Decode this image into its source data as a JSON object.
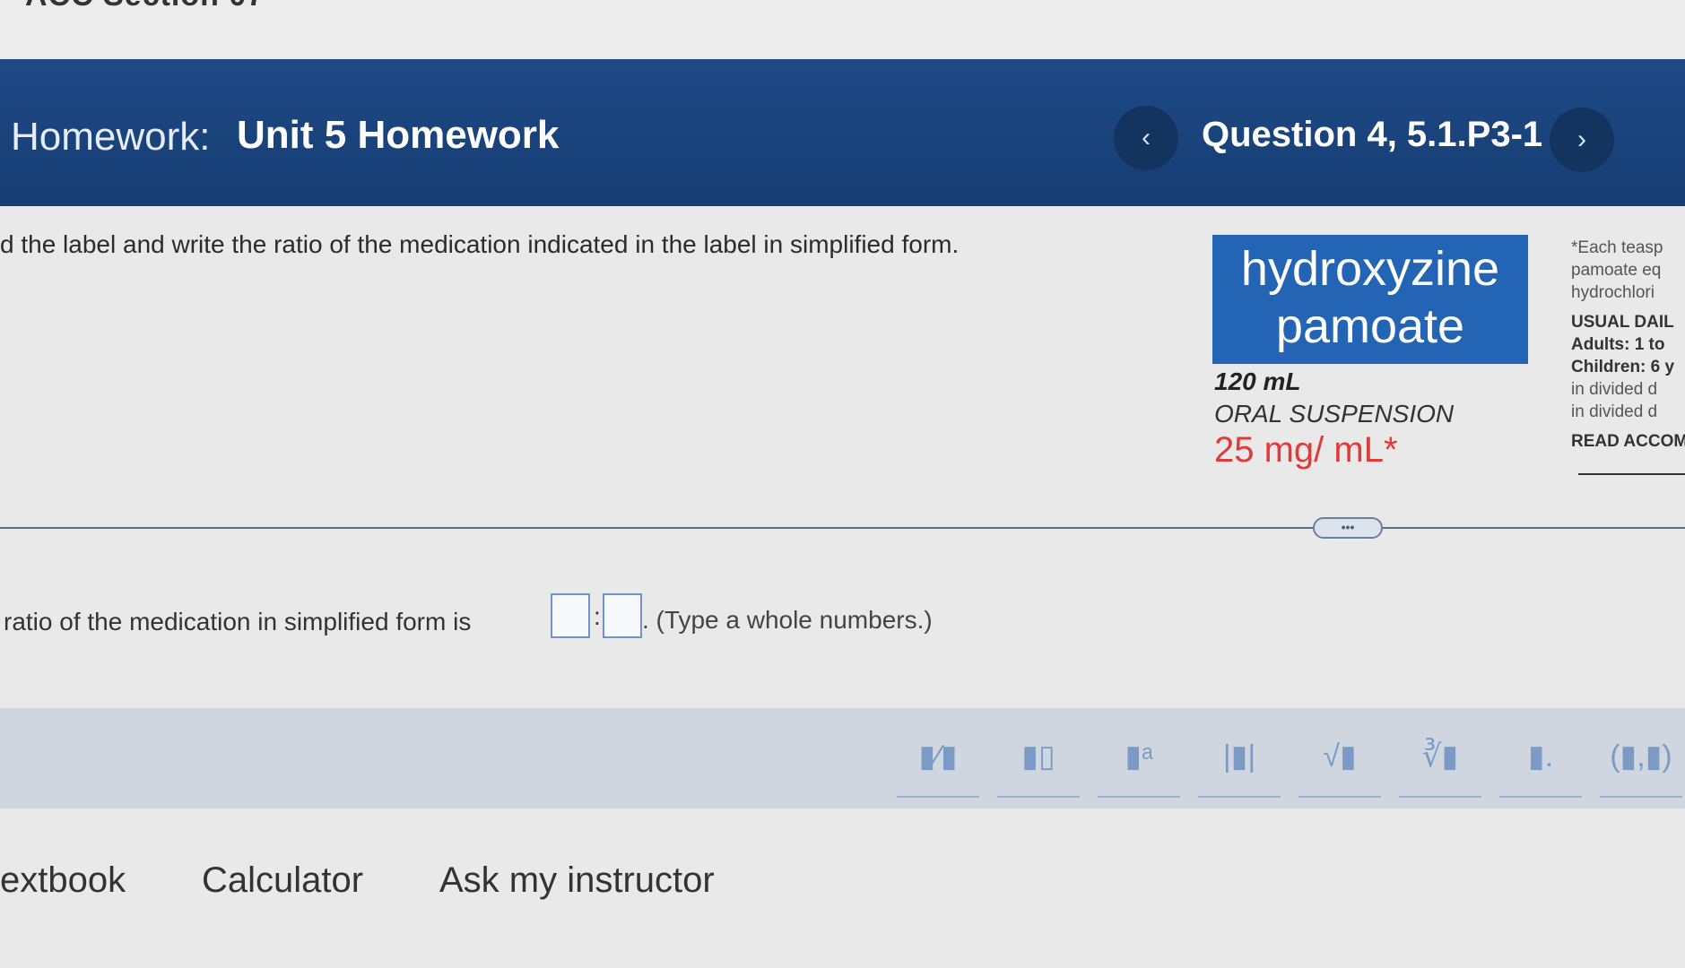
{
  "page": {
    "course_fragment": "ACC Section 07"
  },
  "header": {
    "homework_prefix": "Homework:",
    "homework_title": "Unit 5 Homework",
    "prev_icon": "‹",
    "next_icon": "›",
    "question_title": "Question 4, 5.1.P3-1"
  },
  "question": {
    "instruction": "d the label and write the ratio of the medication indicated in the label in simplified form."
  },
  "medication_label": {
    "name_line1": "hydroxyzine",
    "name_line2": "pamoate",
    "volume": "120 mL",
    "form": "ORAL SUSPENSION",
    "concentration": "25 mg/ mL*",
    "side_lines": [
      "*Each teasp",
      "pamoate eq",
      "hydrochlori",
      "USUAL DAIL",
      "Adults: 1 to",
      "Children: 6 y",
      "in divided d",
      "in divided d",
      "READ ACCOM"
    ]
  },
  "more_button": "•••",
  "answer": {
    "prefix": "ratio of the medication in simplified form is",
    "separator": ":",
    "suffix": ". (Type a whole numbers.)",
    "value1": "",
    "value2": ""
  },
  "toolbar": {
    "tools": [
      {
        "name": "fraction-tool",
        "glyph": "▮⁄▮"
      },
      {
        "name": "mixed-number-tool",
        "glyph": "▮▯"
      },
      {
        "name": "exponent-tool",
        "glyph": "▮ᵃ"
      },
      {
        "name": "absolute-value-tool",
        "glyph": "|▮|"
      },
      {
        "name": "square-root-tool",
        "glyph": "√▮"
      },
      {
        "name": "nth-root-tool",
        "glyph": "∛▮"
      },
      {
        "name": "subscript-tool",
        "glyph": "▮."
      },
      {
        "name": "ordered-pair-tool",
        "glyph": "(▮,▮)"
      }
    ]
  },
  "bottom_links": {
    "textbook": "extbook",
    "calculator": "Calculator",
    "ask_instructor": "Ask my instructor"
  }
}
